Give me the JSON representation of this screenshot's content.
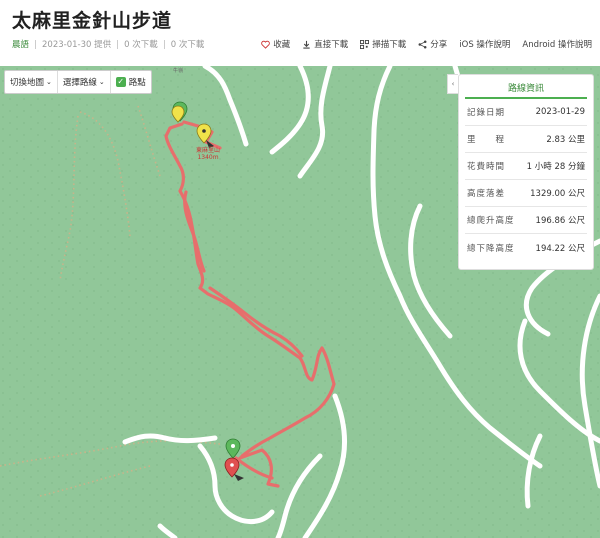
{
  "page": {
    "title": "太麻里金針山步道",
    "author": "晨語",
    "provided_date": "2023-01-30 提供",
    "downloads": "0 次下載",
    "downloads2": "0 次下載"
  },
  "actions": [
    {
      "name": "favorite-button",
      "icon": "heart-icon",
      "label": "收藏"
    },
    {
      "name": "direct-download-button",
      "icon": "download-icon",
      "label": "直接下載"
    },
    {
      "name": "scan-download-button",
      "icon": "qr-icon",
      "label": "掃描下載"
    },
    {
      "name": "share-button",
      "icon": "share-icon",
      "label": "分享"
    },
    {
      "name": "ios-guide-link",
      "icon": "",
      "label": "iOS 操作說明"
    },
    {
      "name": "android-guide-link",
      "icon": "",
      "label": "Android 操作說明"
    }
  ],
  "map_controls": {
    "switch_map": "切換地圖",
    "select_route": "選擇路線",
    "waypoints": "路點"
  },
  "route_info": {
    "title": "路線資訊",
    "rows": [
      {
        "label": "記錄日期",
        "value": "2023-01-29"
      },
      {
        "label": "里　　程",
        "value": "2.83 公里"
      },
      {
        "label": "花費時間",
        "value": "1 小時 28 分鐘"
      },
      {
        "label": "高度落差",
        "value": "1329.00 公尺"
      },
      {
        "label": "總爬升高度",
        "value": "196.86 公尺"
      },
      {
        "label": "總下降高度",
        "value": "194.22 公尺"
      }
    ]
  },
  "map_labels": {
    "peak_name": "東麻里山",
    "peak_elevation": "1340m",
    "top_road_label": "牛嶺"
  },
  "colors": {
    "map_bg": "#91c799",
    "track": "#ec6a6a",
    "road": "#ffffff",
    "trail_dotted": "#c9b48a",
    "accent": "#4caf50"
  }
}
